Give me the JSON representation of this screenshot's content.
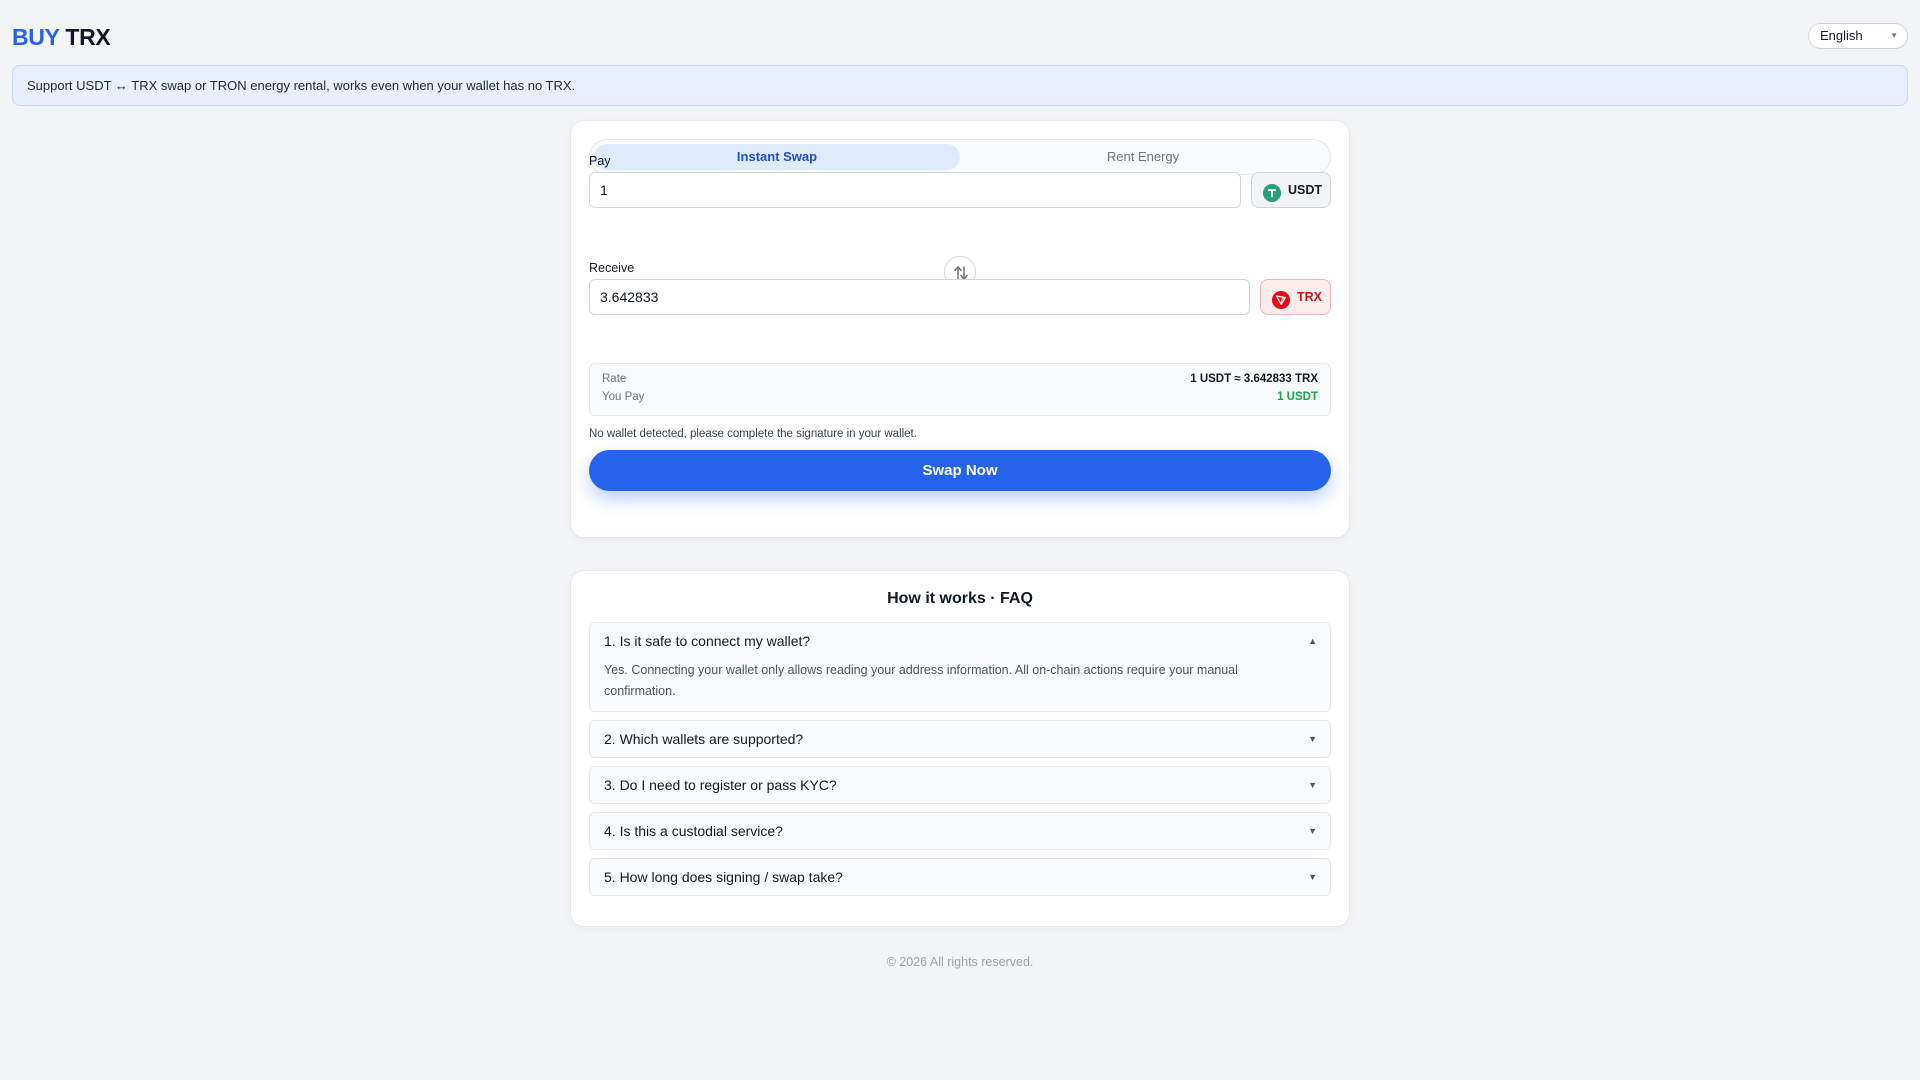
{
  "header": {
    "logo_part1": "BUY",
    "logo_part2": "TRX",
    "language": "English"
  },
  "banner": {
    "text": "Support USDT ↔ TRX swap or TRON energy rental, works even when your wallet has no TRX."
  },
  "tabs": {
    "swap": "Instant Swap",
    "rent": "Rent Energy"
  },
  "pay": {
    "label": "Pay",
    "value": "1",
    "token": "USDT",
    "token_color": "#26a17b"
  },
  "receive": {
    "label": "Receive",
    "value": "3.642833",
    "token": "TRX",
    "token_color": "#e50914"
  },
  "info": {
    "rate_label": "Rate",
    "rate_value": "1 USDT ≈ 3.642833 TRX",
    "pay_label": "You Pay",
    "pay_value": "1 USDT",
    "pay_value_color": "#16a34a"
  },
  "wallet_message": "No wallet detected, please complete the signature in your wallet.",
  "swap_button": "Swap Now",
  "faq": {
    "title": "How it works · FAQ",
    "items": [
      {
        "question": "1. Is it safe to connect my wallet?",
        "answer": "Yes. Connecting your wallet only allows reading your address information. All on-chain actions require your manual confirmation.",
        "expanded": true
      },
      {
        "question": "2. Which wallets are supported?",
        "expanded": false
      },
      {
        "question": "3. Do I need to register or pass KYC?",
        "expanded": false
      },
      {
        "question": "4. Is this a custodial service?",
        "expanded": false
      },
      {
        "question": "5. How long does signing / swap take?",
        "expanded": false
      }
    ]
  },
  "footer": "© 2026 All rights reserved.",
  "colors": {
    "accent": "#2563eb",
    "background": "#f3f4f6"
  }
}
